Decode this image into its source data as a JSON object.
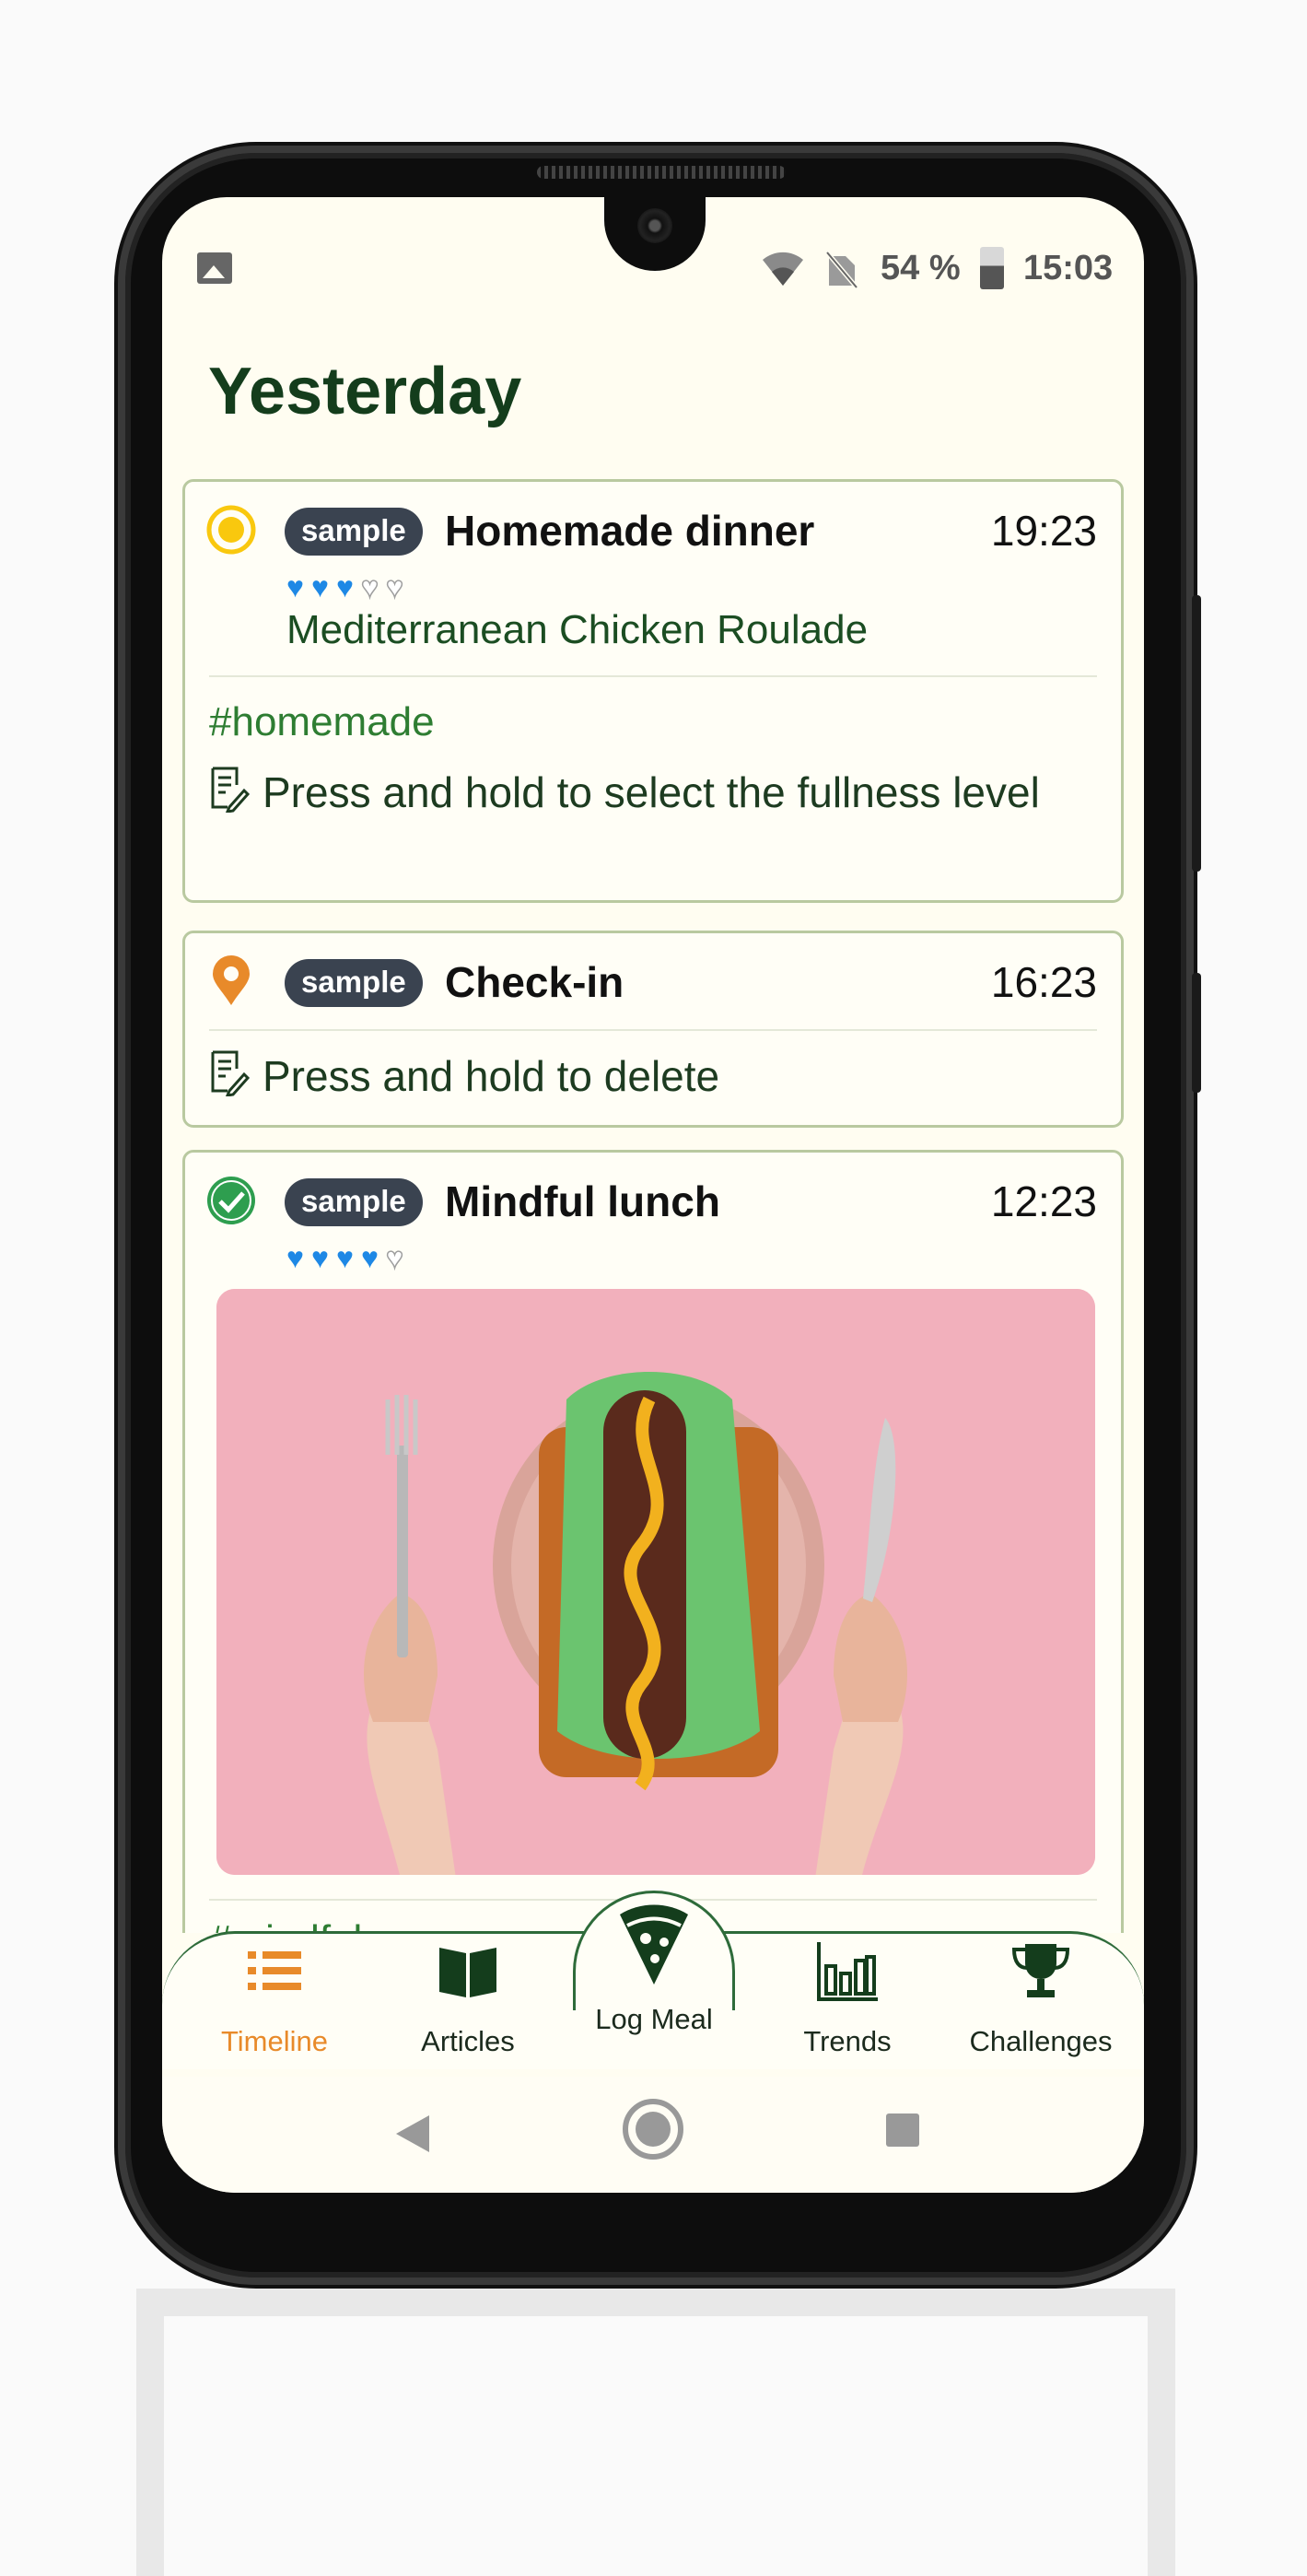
{
  "status_bar": {
    "battery_percent": "54 %",
    "time": "15:03"
  },
  "page": {
    "title": "Yesterday"
  },
  "entries": [
    {
      "status": "pending",
      "status_color": "#f9c80e",
      "badge": "sample",
      "title": "Homemade dinner",
      "time": "19:23",
      "fullness": 3,
      "fullness_max": 5,
      "meal_name": "Mediterranean Chicken Roulade",
      "hashtag": "#homemade",
      "note": "Press and hold to select the fullness level"
    },
    {
      "status": "location",
      "status_color": "#e88a2a",
      "badge": "sample",
      "title": "Check-in",
      "time": "16:23",
      "note": "Press and hold to delete"
    },
    {
      "status": "done",
      "status_color": "#2e9e4f",
      "badge": "sample",
      "title": "Mindful lunch",
      "time": "12:23",
      "fullness": 4,
      "fullness_max": 5,
      "hashtag": "#mindful"
    }
  ],
  "bottom_nav": {
    "items": [
      {
        "label": "Timeline",
        "icon": "list-icon",
        "active": true
      },
      {
        "label": "Articles",
        "icon": "book-icon",
        "active": false
      },
      {
        "label": "Log Meal",
        "icon": "pizza-slice-icon",
        "active": false
      },
      {
        "label": "Trends",
        "icon": "bar-chart-icon",
        "active": false
      },
      {
        "label": "Challenges",
        "icon": "trophy-icon",
        "active": false
      }
    ]
  },
  "colors": {
    "accent": "#e88a2a",
    "primary": "#143d1c",
    "heart": "#1e88e5",
    "badge": "#3a4350",
    "card_border": "#b9c9a0"
  }
}
